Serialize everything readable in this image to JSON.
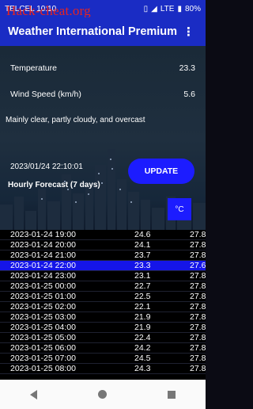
{
  "status_bar": {
    "carrier_time": "TELCEL  10:10",
    "network": "LTE",
    "battery": "80%"
  },
  "watermark": "Hack-cheat.org",
  "app": {
    "title": "Weather International Premium"
  },
  "weather": {
    "temperature_label": "Temperature",
    "temperature_value": "23.3",
    "wind_label": "Wind Speed (km/h)",
    "wind_value": "5.6",
    "description": "Mainly clear, partly cloudy, and overcast",
    "timestamp": "2023/01/24 22:10:01",
    "update_label": "UPDATE"
  },
  "hourly": {
    "title": "Hourly Forecast (7 days)",
    "unit": "°C",
    "rows": [
      {
        "time": "2023-01-24 19:00",
        "temp": "24.6",
        "extra": "27.8"
      },
      {
        "time": "2023-01-24 20:00",
        "temp": "24.1",
        "extra": "27.8"
      },
      {
        "time": "2023-01-24 21:00",
        "temp": "23.7",
        "extra": "27.8"
      },
      {
        "time": "2023-01-24 22:00",
        "temp": "23.3",
        "extra": "27.6"
      },
      {
        "time": "2023-01-24 23:00",
        "temp": "23.1",
        "extra": "27.8"
      },
      {
        "time": "2023-01-25 00:00",
        "temp": "22.7",
        "extra": "27.8"
      },
      {
        "time": "2023-01-25 01:00",
        "temp": "22.5",
        "extra": "27.8"
      },
      {
        "time": "2023-01-25 02:00",
        "temp": "22.1",
        "extra": "27.8"
      },
      {
        "time": "2023-01-25 03:00",
        "temp": "21.9",
        "extra": "27.8"
      },
      {
        "time": "2023-01-25 04:00",
        "temp": "21.9",
        "extra": "27.8"
      },
      {
        "time": "2023-01-25 05:00",
        "temp": "22.4",
        "extra": "27.8"
      },
      {
        "time": "2023-01-25 06:00",
        "temp": "24.2",
        "extra": "27.8"
      },
      {
        "time": "2023-01-25 07:00",
        "temp": "24.5",
        "extra": "27.8"
      },
      {
        "time": "2023-01-25 08:00",
        "temp": "24.3",
        "extra": "27.8"
      }
    ]
  },
  "selected_row": 3,
  "colors": {
    "primary": "#1a2cc4",
    "button": "#1c1cff",
    "selected_row": "#1515e8"
  }
}
